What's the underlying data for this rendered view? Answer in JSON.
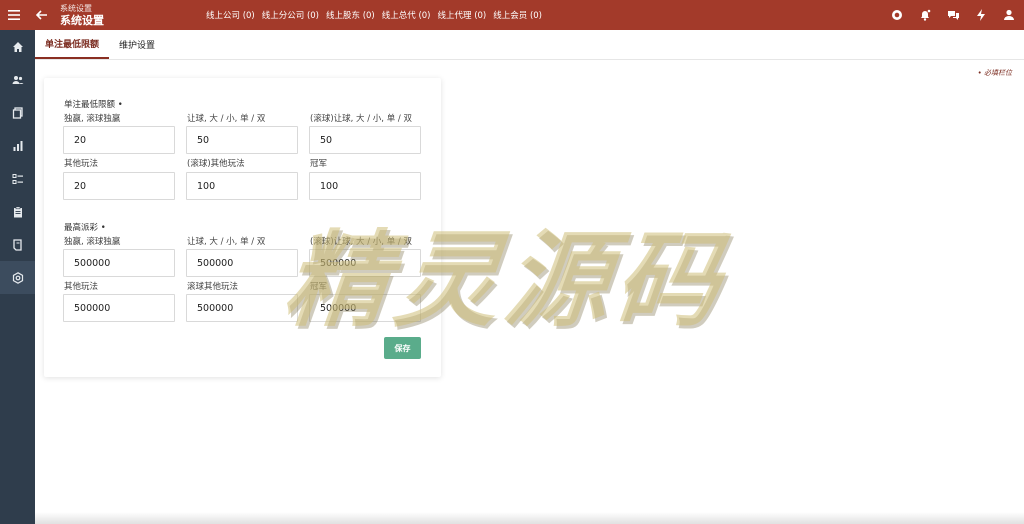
{
  "header": {
    "breadcrumb_small": "系统设置",
    "title": "系统设置",
    "counters": [
      "线上公司 (0)",
      "线上分公司 (0)",
      "线上股东 (0)",
      "线上总代 (0)",
      "线上代理 (0)",
      "线上会员 (0)"
    ],
    "icons": [
      "menu-icon",
      "back-arrow-icon",
      "search-icon",
      "bell-icon",
      "chat-icon",
      "lightning-icon",
      "user-icon"
    ]
  },
  "sidebar": {
    "items": [
      "home-icon",
      "users-icon",
      "copy-icon",
      "chart-icon",
      "list-icon",
      "clipboard-icon",
      "book-icon",
      "settings-icon"
    ],
    "active_index": 7
  },
  "tabs": [
    {
      "label": "单注最低限额",
      "active": true
    },
    {
      "label": "维护设置",
      "active": false
    }
  ],
  "required_note": "• 必填栏位",
  "form": {
    "section_min": "单注最低限额 •",
    "section_max": "最高派彩 •",
    "min_fields": [
      {
        "label": "独赢, 滚球独赢",
        "value": "20"
      },
      {
        "label": "让球, 大 / 小, 单 / 双",
        "value": "50"
      },
      {
        "label": "(滚球)让球, 大 / 小, 单 / 双",
        "value": "50"
      },
      {
        "label": "其他玩法",
        "value": "20"
      },
      {
        "label": "(滚球)其他玩法",
        "value": "100"
      },
      {
        "label": "冠军",
        "value": "100"
      }
    ],
    "max_fields": [
      {
        "label": "独赢, 滚球独赢",
        "value": "500000"
      },
      {
        "label": "让球, 大 / 小, 单 / 双",
        "value": "500000"
      },
      {
        "label": "(滚球)让球, 大 / 小, 单 / 双",
        "value": "500000"
      },
      {
        "label": "其他玩法",
        "value": "500000"
      },
      {
        "label": "滚球其他玩法",
        "value": "500000"
      },
      {
        "label": "冠军",
        "value": "500000"
      }
    ],
    "save_label": "保存"
  },
  "watermark": "精灵源码",
  "colors": {
    "topbar": "#a33a2a",
    "sidebar": "#2f3d4c",
    "save_button": "#5aac8b",
    "accent": "#7a2a1e"
  }
}
